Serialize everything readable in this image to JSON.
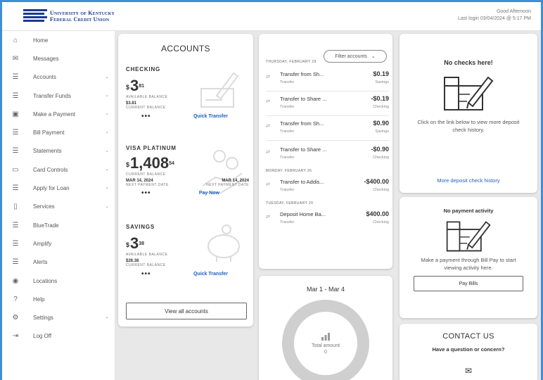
{
  "header": {
    "logo_line1": "University of Kentucky",
    "logo_line2": "Federal Credit Union",
    "greeting": "Good Afternoon",
    "last_login": "Last login 03/04/2024 @ 5:17 PM"
  },
  "sidebar": {
    "items": [
      {
        "label": "Home",
        "icon": "home-icon",
        "glyph": "⌂",
        "chevron": false
      },
      {
        "label": "Messages",
        "icon": "envelope-icon",
        "glyph": "✉",
        "chevron": false
      },
      {
        "label": "Accounts",
        "icon": "list-icon",
        "glyph": "☰",
        "chevron": true
      },
      {
        "label": "Transfer Funds",
        "icon": "list-icon",
        "glyph": "☰",
        "chevron": true
      },
      {
        "label": "Make a Payment",
        "icon": "money-icon",
        "glyph": "▣",
        "chevron": true
      },
      {
        "label": "Bill Payment",
        "icon": "list-icon",
        "glyph": "☰",
        "chevron": true
      },
      {
        "label": "Statements",
        "icon": "list-icon",
        "glyph": "☰",
        "chevron": true
      },
      {
        "label": "Card Controls",
        "icon": "card-icon",
        "glyph": "▭",
        "chevron": true
      },
      {
        "label": "Apply for Loan",
        "icon": "list-icon",
        "glyph": "☰",
        "chevron": true
      },
      {
        "label": "Services",
        "icon": "clipboard-icon",
        "glyph": "▯",
        "chevron": true
      },
      {
        "label": "BlueTrade",
        "icon": "list-icon",
        "glyph": "☰",
        "chevron": false
      },
      {
        "label": "Amplify",
        "icon": "list-icon",
        "glyph": "☰",
        "chevron": false
      },
      {
        "label": "Alerts",
        "icon": "list-icon",
        "glyph": "☰",
        "chevron": false
      },
      {
        "label": "Locations",
        "icon": "location-pin-icon",
        "glyph": "◉",
        "chevron": false
      },
      {
        "label": "Help",
        "icon": "help-icon",
        "glyph": "?",
        "chevron": false
      },
      {
        "label": "Settings",
        "icon": "gear-icon",
        "glyph": "⚙",
        "chevron": true
      },
      {
        "label": "Log Off",
        "icon": "logout-icon",
        "glyph": "⇥",
        "chevron": false
      }
    ]
  },
  "accounts": {
    "title": "ACCOUNTS",
    "checking": {
      "name": "CHECKING",
      "currency": "$",
      "amount": "3",
      "cents": "81",
      "available_label": "AVAILABLE BALANCE",
      "current_value": "$3.81",
      "current_label": "CURRENT BALANCE",
      "more": "•••",
      "action": "Quick Transfer"
    },
    "visa": {
      "name": "VISA PLATINUM",
      "currency": "$",
      "amount": "1,408",
      "cents": "54",
      "current_label": "CURRENT BALANCE",
      "due_date": "MAR 14, 2024",
      "due_label": "NEXT PAYMENT DATE",
      "due_date2": "MAR 14, 2024",
      "due_label2": "NEXT PAYMENT DATE",
      "more": "•••",
      "action": "Pay Now"
    },
    "savings": {
      "name": "SAVINGS",
      "currency": "$",
      "amount": "3",
      "cents": "38",
      "available_label": "AVAILABLE BALANCE",
      "current_value": "$28.38",
      "current_label": "CURRENT BALANCE",
      "more": "•••",
      "action": "Quick Transfer"
    },
    "view_all": "View all accounts"
  },
  "transactions": {
    "filter_label": "Filter accounts",
    "days": [
      {
        "label": "THURSDAY, FEBRUARY 29"
      },
      {
        "label": "MONDAY, FEBRUARY 26"
      },
      {
        "label": "TUESDAY, FEBRUARY 20"
      }
    ],
    "rows": [
      {
        "name": "Transfer from Sh...",
        "type": "Transfer",
        "amount": "$0.19",
        "account": "Savings"
      },
      {
        "name": "Transfer to Share ...",
        "type": "Transfer",
        "amount": "-$0.19",
        "account": "Checking"
      },
      {
        "name": "Transfer from Sh...",
        "type": "Transfer",
        "amount": "$0.90",
        "account": "Savings"
      },
      {
        "name": "Transfer to Share ...",
        "type": "Transfer",
        "amount": "-$0.90",
        "account": "Checking"
      },
      {
        "name": "Transfer to Addis...",
        "type": "Transfer",
        "amount": "-$400.00",
        "account": "Checking"
      },
      {
        "name": "Deposit Home Ba...",
        "type": "Transfer",
        "amount": "$400.00",
        "account": "Checking"
      }
    ]
  },
  "spending": {
    "range": "Mar 1 - Mar 4",
    "total_label": "Total amount",
    "total_value": "0"
  },
  "checks": {
    "title": "No checks here!",
    "body": "Click on the link below to view more deposit check history.",
    "link": "More deposit check history"
  },
  "payment": {
    "title": "No payment activity",
    "body": "Make a payment through Bill Pay to start viewing activity here.",
    "button": "Pay Bills"
  },
  "contact": {
    "title": "CONTACT US",
    "subtitle": "Have a question or concern?"
  },
  "colors": {
    "brand": "#1a3a8f",
    "link": "#1f5fc2",
    "background_frame": "#3d8fd6"
  }
}
